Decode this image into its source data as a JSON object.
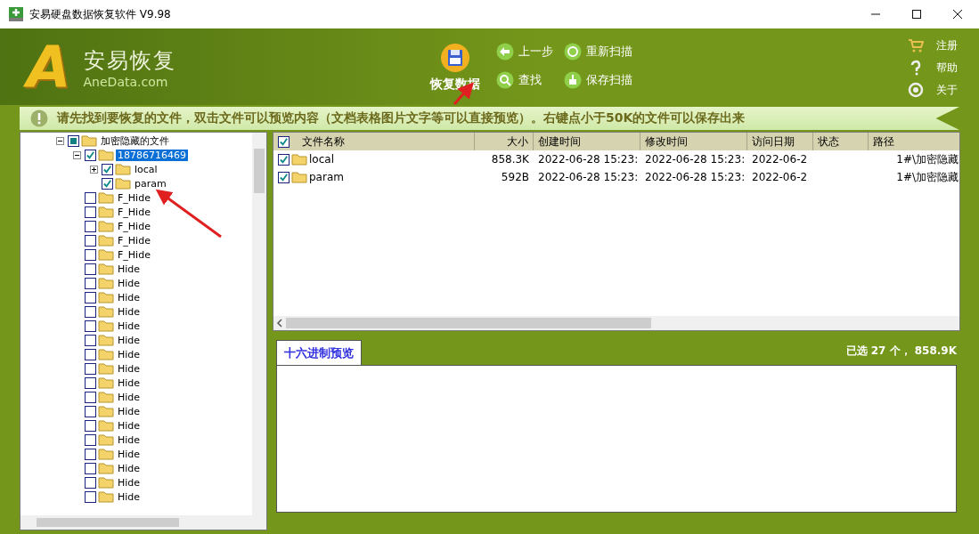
{
  "window": {
    "title": "安易硬盘数据恢复软件 V9.98"
  },
  "brand": {
    "mark": "A",
    "name": "安易恢复",
    "site": "AneData.com"
  },
  "toolbar": {
    "main": {
      "label": "恢复数据"
    },
    "buttons": [
      {
        "label": "上一步",
        "kind": "back"
      },
      {
        "label": "重新扫描",
        "kind": "rescan"
      },
      {
        "label": "查找",
        "kind": "search"
      },
      {
        "label": "保存扫描",
        "kind": "save"
      }
    ],
    "links": [
      {
        "label": "注册",
        "kind": "cart"
      },
      {
        "label": "帮助",
        "kind": "help"
      },
      {
        "label": "关于",
        "kind": "about"
      }
    ]
  },
  "notice": {
    "text": "请先找到要恢复的文件，双击文件可以预览内容（文档表格图片文字等可以直接预览）。右键点小于50K的文件可以保存出来"
  },
  "tree": [
    {
      "label": "加密隐藏的文件",
      "checked": false,
      "partial": true,
      "selected": false,
      "expanded": true,
      "children": [
        {
          "label": "18786716469",
          "checked": true,
          "selected": true,
          "expanded": true,
          "children": [
            {
              "label": "local",
              "checked": true,
              "selected": false,
              "expanded": false
            },
            {
              "label": "param",
              "checked": true,
              "selected": false
            }
          ]
        },
        {
          "label": "F_Hide",
          "checked": false,
          "selected": false
        },
        {
          "label": "F_Hide",
          "checked": false,
          "selected": false
        },
        {
          "label": "F_Hide",
          "checked": false,
          "selected": false
        },
        {
          "label": "F_Hide",
          "checked": false,
          "selected": false
        },
        {
          "label": "F_Hide",
          "checked": false,
          "selected": false
        },
        {
          "label": "Hide",
          "checked": false,
          "selected": false
        },
        {
          "label": "Hide",
          "checked": false,
          "selected": false
        },
        {
          "label": "Hide",
          "checked": false,
          "selected": false
        },
        {
          "label": "Hide",
          "checked": false,
          "selected": false
        },
        {
          "label": "Hide",
          "checked": false,
          "selected": false
        },
        {
          "label": "Hide",
          "checked": false,
          "selected": false
        },
        {
          "label": "Hide",
          "checked": false,
          "selected": false
        },
        {
          "label": "Hide",
          "checked": false,
          "selected": false
        },
        {
          "label": "Hide",
          "checked": false,
          "selected": false
        },
        {
          "label": "Hide",
          "checked": false,
          "selected": false
        },
        {
          "label": "Hide",
          "checked": false,
          "selected": false
        },
        {
          "label": "Hide",
          "checked": false,
          "selected": false
        },
        {
          "label": "Hide",
          "checked": false,
          "selected": false
        },
        {
          "label": "Hide",
          "checked": false,
          "selected": false
        },
        {
          "label": "Hide",
          "checked": false,
          "selected": false
        },
        {
          "label": "Hide",
          "checked": false,
          "selected": false
        },
        {
          "label": "Hide",
          "checked": false,
          "selected": false
        }
      ]
    }
  ],
  "table": {
    "all_checked": true,
    "columns": [
      "文件名称",
      "大小",
      "创建时间",
      "修改时间",
      "访问日期",
      "状态",
      "路径"
    ],
    "rows": [
      {
        "checked": true,
        "name": "local",
        "size": "858.3K",
        "created": "2022-06-28 15:23:",
        "modified": "2022-06-28 15:23:",
        "accessed": "2022-06-2",
        "path": "1#\\加密隐藏"
      },
      {
        "checked": true,
        "name": "param",
        "size": "592B",
        "created": "2022-06-28 15:23:",
        "modified": "2022-06-28 15:23:",
        "accessed": "2022-06-2",
        "path": "1#\\加密隐藏"
      }
    ]
  },
  "preview": {
    "tabs": [
      {
        "label": "十六进制预览",
        "selected": true
      }
    ],
    "summary": "已选 27 个， 858.9K"
  }
}
